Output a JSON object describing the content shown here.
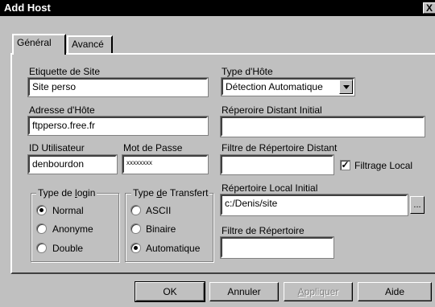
{
  "window": {
    "title": "Add Host",
    "close_label": "X"
  },
  "tabs": [
    {
      "label": "Général",
      "active": true
    },
    {
      "label": "Avancé",
      "active": false
    }
  ],
  "site_label": {
    "label": "Etiquette de Site",
    "value": "Site perso"
  },
  "host_address": {
    "label": "Adresse d'Hôte",
    "value": "ftpperso.free.fr"
  },
  "user_id": {
    "label": "ID Utilisateur",
    "value": "denbourdon"
  },
  "password": {
    "label": "Mot de Passe",
    "value": "xxxxxxxx"
  },
  "host_type": {
    "label": "Type d'Hôte",
    "value": "Détection Automatique"
  },
  "remote_dir": {
    "label": "Réperoire Distant Initial",
    "value": ""
  },
  "remote_filter": {
    "label": "Filtre de Répertoire Distant",
    "value": ""
  },
  "local_filter_check": {
    "label": "Filtrage Local",
    "checked": true
  },
  "local_dir": {
    "label": "Répertoire Local Initial",
    "value": "c:/Denis/site",
    "browse_label": "..."
  },
  "dir_filter": {
    "label": "Filtre de Répertoire",
    "value": ""
  },
  "login_type": {
    "legend_pre": "Type de ",
    "legend_key": "l",
    "legend_post": "ogin",
    "options": [
      {
        "label": "Normal",
        "selected": true
      },
      {
        "label": "Anonyme",
        "selected": false
      },
      {
        "label": "Double",
        "selected": false
      }
    ]
  },
  "transfer_type": {
    "legend_pre": "Type ",
    "legend_key": "d",
    "legend_post": "e Transfert",
    "options": [
      {
        "label": "ASCII",
        "selected": false
      },
      {
        "label": "Binaire",
        "selected": false
      },
      {
        "label": "Automatique",
        "selected": true
      }
    ]
  },
  "buttons": {
    "ok": "OK",
    "cancel": "Annuler",
    "apply_key": "A",
    "apply_rest": "ppliquer",
    "help": "Aide"
  }
}
